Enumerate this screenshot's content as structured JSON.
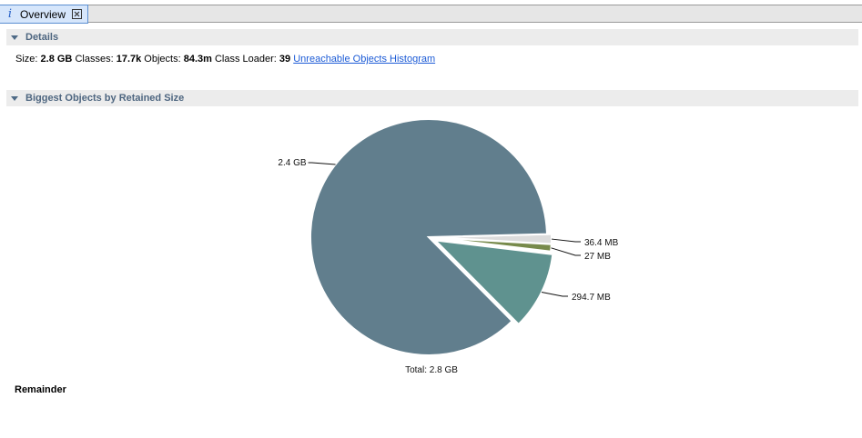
{
  "tab": {
    "label": "Overview",
    "info_glyph": "i"
  },
  "details": {
    "title": "Details",
    "size_label": "Size:",
    "size_value": "2.8 GB",
    "classes_label": "Classes:",
    "classes_value": "17.7k",
    "objects_label": "Objects:",
    "objects_value": "84.3m",
    "loader_label": "Class Loader:",
    "loader_value": "39",
    "link_label": "Unreachable Objects Histogram"
  },
  "biggest": {
    "title": "Biggest Objects by Retained Size",
    "total_label": "Total: 2.8 GB",
    "remainder_label": "Remainder"
  },
  "chart_data": {
    "type": "pie",
    "total": "Total: 2.8 GB",
    "slices": [
      {
        "label": "2.4 GB",
        "value": 2.4,
        "color": "#617e8d"
      },
      {
        "label": "294.7 MB",
        "value": 0.2947,
        "color": "#5f928f"
      },
      {
        "label": "27 MB",
        "value": 0.027,
        "color": "#778a4b"
      },
      {
        "label": "36.4 MB",
        "value": 0.0364,
        "color": "#dcdcdc"
      }
    ]
  },
  "colors": {
    "tab_bg": "#d6e6fb",
    "header_text": "#4e6680",
    "link": "#1c5bd6"
  }
}
